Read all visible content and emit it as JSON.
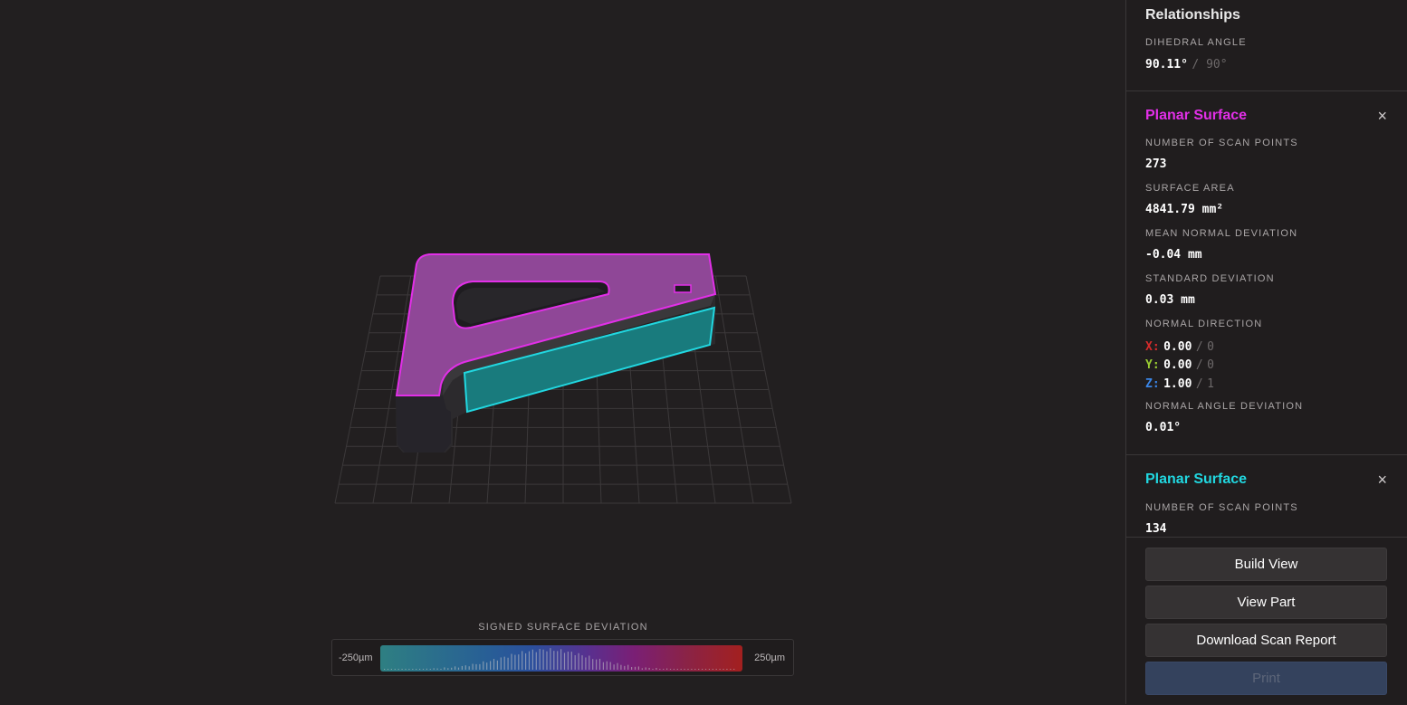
{
  "legend": {
    "title": "SIGNED SURFACE DEVIATION",
    "min_label": "-250µm",
    "max_label": "250µm"
  },
  "colors": {
    "highlight_primary": "#e22fe8",
    "highlight_secondary": "#21d7e0",
    "axis_x": "#d62b2b",
    "axis_y": "#9acd32",
    "axis_z": "#3a86e8",
    "primary_button": "#34425d"
  },
  "panel": {
    "relationships": {
      "title": "Relationships",
      "dihedral_label": "DIHEDRAL ANGLE",
      "dihedral_value": "90.11°",
      "dihedral_ref": "90°"
    },
    "surface1": {
      "title": "Planar Surface",
      "close_icon": "×",
      "scan_points_label": "NUMBER OF SCAN POINTS",
      "scan_points_value": "273",
      "area_label": "SURFACE AREA",
      "area_value": "4841.79 mm²",
      "mean_dev_label": "MEAN NORMAL DEVIATION",
      "mean_dev_value": "-0.04 mm",
      "std_dev_label": "STANDARD DEVIATION",
      "std_dev_value": "0.03 mm",
      "normal_dir_label": "NORMAL DIRECTION",
      "x_letter": "X:",
      "x_value": "0.00",
      "x_ref": "0",
      "y_letter": "Y:",
      "y_value": "0.00",
      "y_ref": "0",
      "z_letter": "Z:",
      "z_value": "1.00",
      "z_ref": "1",
      "angle_dev_label": "NORMAL ANGLE DEVIATION",
      "angle_dev_value": "0.01°"
    },
    "surface2": {
      "title": "Planar Surface",
      "close_icon": "×",
      "scan_points_label": "NUMBER OF SCAN POINTS",
      "scan_points_value": "134"
    }
  },
  "buttons": {
    "build_view": "Build View",
    "view_part": "View Part",
    "download_report": "Download Scan Report",
    "print": "Print"
  }
}
